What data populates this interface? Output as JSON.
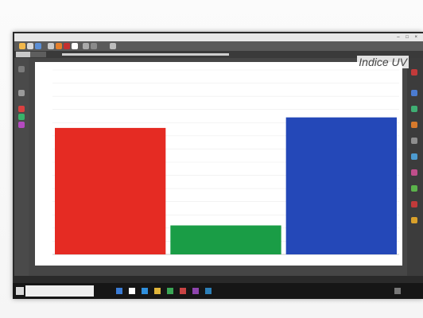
{
  "window": {
    "title": "",
    "controls": "– □ ×"
  },
  "chart_data": {
    "type": "bar",
    "title": "Indice UV",
    "categories": [
      "",
      "",
      ""
    ],
    "values": [
      9.6,
      2.2,
      10.4
    ],
    "colors": [
      "#e52b23",
      "#1a9d46",
      "#2448b8"
    ],
    "ylim": [
      0,
      14
    ],
    "grid": true,
    "xlabel": "",
    "ylabel": ""
  },
  "taskbar": {
    "active_item": ""
  }
}
